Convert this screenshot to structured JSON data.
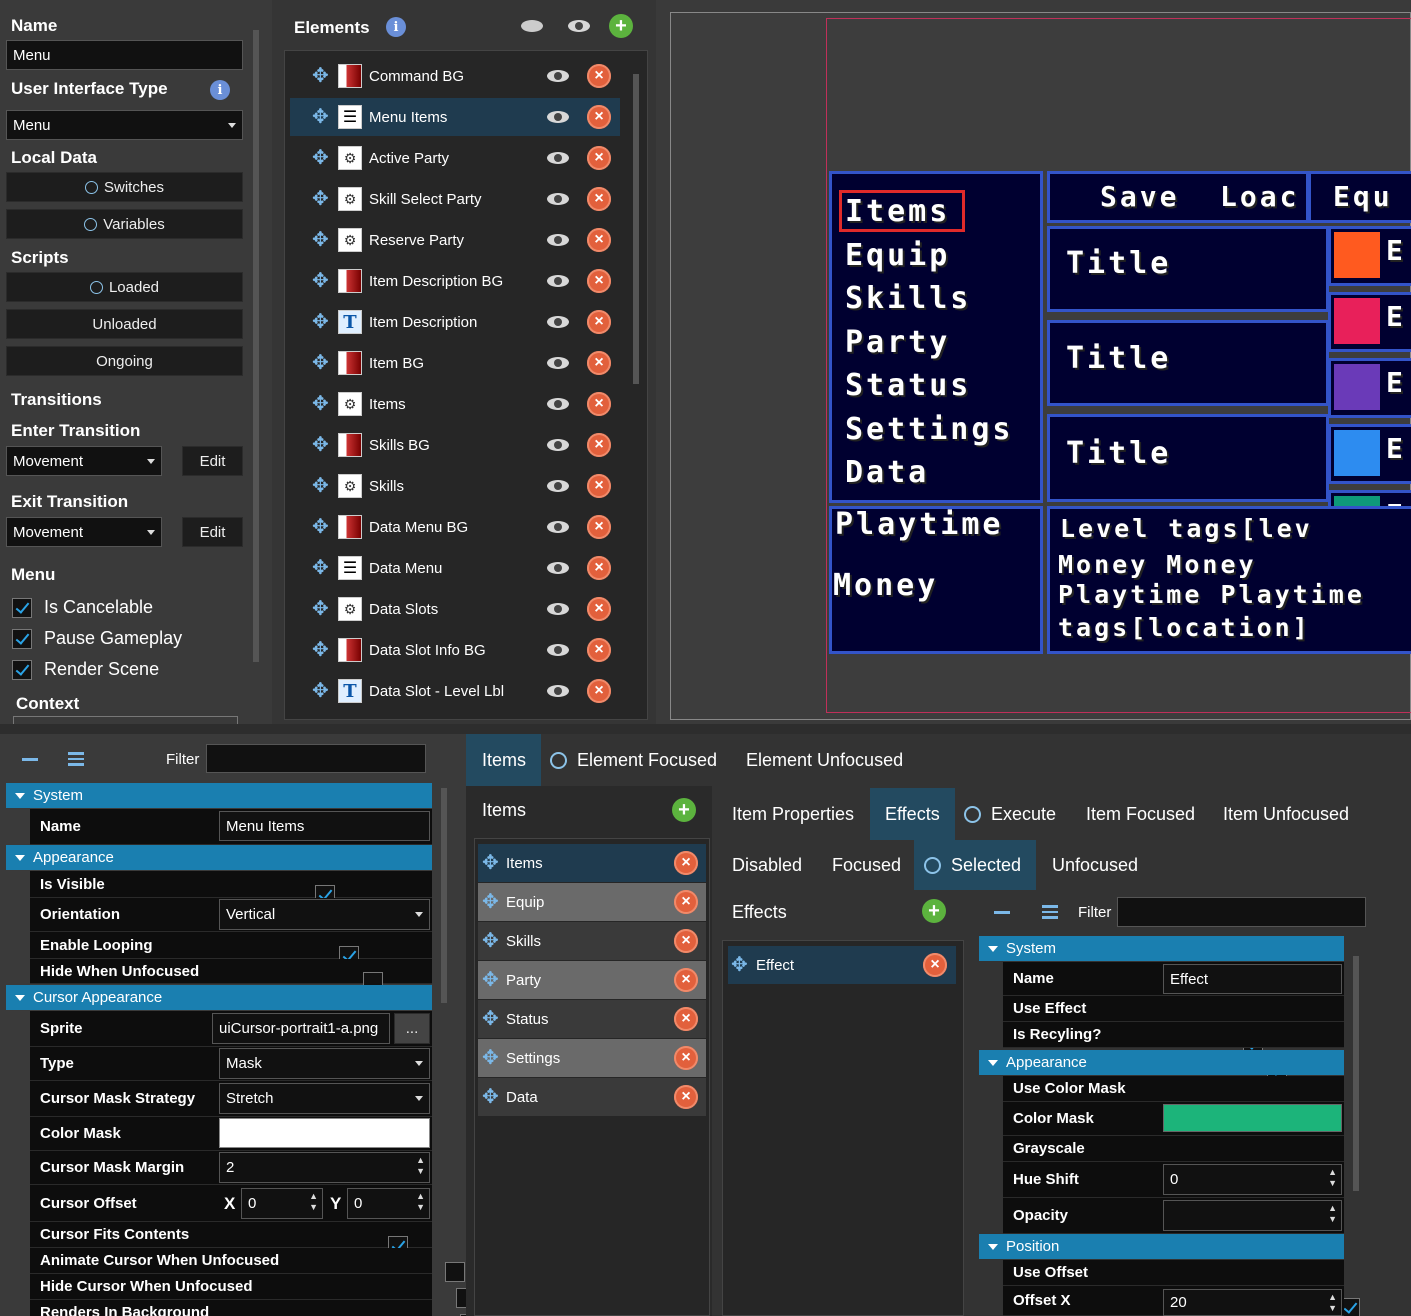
{
  "left_panel": {
    "name_label": "Name",
    "name_value": "Menu",
    "ui_type_label": "User Interface Type",
    "ui_type_value": "Menu",
    "local_data_label": "Local Data",
    "switches": "Switches",
    "variables": "Variables",
    "scripts_label": "Scripts",
    "loaded": "Loaded",
    "unloaded": "Unloaded",
    "ongoing": "Ongoing",
    "transitions_label": "Transitions",
    "enter_transition_label": "Enter Transition",
    "enter_transition_value": "Movement",
    "exit_transition_label": "Exit Transition",
    "exit_transition_value": "Movement",
    "edit": "Edit",
    "menu_label": "Menu",
    "is_cancelable": "Is Cancelable",
    "pause_gameplay": "Pause Gameplay",
    "render_scene": "Render Scene",
    "context_label": "Context"
  },
  "elements_panel": {
    "title": "Elements",
    "items": [
      {
        "label": "Command BG",
        "icon": "background-icon"
      },
      {
        "label": "Menu Items",
        "icon": "list-icon"
      },
      {
        "label": "Active Party",
        "icon": "grid-icon"
      },
      {
        "label": "Skill Select Party",
        "icon": "grid-icon"
      },
      {
        "label": "Reserve Party",
        "icon": "grid-icon"
      },
      {
        "label": "Item Description BG",
        "icon": "background-icon"
      },
      {
        "label": "Item Description",
        "icon": "text-icon"
      },
      {
        "label": "Item BG",
        "icon": "background-icon"
      },
      {
        "label": "Items",
        "icon": "grid-icon"
      },
      {
        "label": "Skills BG",
        "icon": "background-icon"
      },
      {
        "label": "Skills",
        "icon": "grid-icon"
      },
      {
        "label": "Data Menu BG",
        "icon": "background-icon"
      },
      {
        "label": "Data Menu",
        "icon": "list-icon"
      },
      {
        "label": "Data Slots",
        "icon": "grid-icon"
      },
      {
        "label": "Data Slot Info BG",
        "icon": "background-icon"
      },
      {
        "label": "Data Slot - Level Lbl",
        "icon": "text-icon"
      }
    ]
  },
  "preview": {
    "menu": [
      "Items",
      "Equip",
      "Skills",
      "Party",
      "Status",
      "Settings",
      "Data"
    ],
    "top": [
      "Save",
      "Loac",
      "Equ"
    ],
    "titles": [
      "Title",
      "Title",
      "Title"
    ],
    "playtime": "Playtime",
    "money": "Money",
    "info_lines": [
      "Level tags[lev",
      "Money Money",
      "Playtime Playtime",
      "tags[location]"
    ],
    "swatch_letter": "E",
    "swatches": [
      "#ff5a1f",
      "#e8205a",
      "#6a3ab8",
      "#2d8cf0",
      "#0e9a7a"
    ]
  },
  "props": {
    "filter": "Filter",
    "system": "System",
    "name": "Name",
    "name_value": "Menu Items",
    "appearance": "Appearance",
    "is_visible": "Is Visible",
    "orientation": "Orientation",
    "orientation_value": "Vertical",
    "enable_looping": "Enable Looping",
    "hide_when_unfocused": "Hide When Unfocused",
    "cursor_appearance": "Cursor Appearance",
    "sprite": "Sprite",
    "sprite_value": "uiCursor-portrait1-a.png",
    "browse": "...",
    "type": "Type",
    "type_value": "Mask",
    "cursor_mask_strategy": "Cursor Mask Strategy",
    "cursor_mask_strategy_value": "Stretch",
    "color_mask": "Color Mask",
    "cursor_mask_margin": "Cursor Mask Margin",
    "cursor_mask_margin_value": "2",
    "cursor_offset": "Cursor Offset",
    "x": "X",
    "y": "Y",
    "offset_x_value": "0",
    "offset_y_value": "0",
    "cursor_fits_contents": "Cursor Fits Contents",
    "animate_cursor": "Animate Cursor When Unfocused",
    "hide_cursor": "Hide Cursor When Unfocused",
    "renders_bg": "Renders In Background"
  },
  "tabs_top": {
    "items": "Items",
    "element_focused": "Element Focused",
    "element_unfocused": "Element Unfocused"
  },
  "items_list": {
    "title": "Items",
    "entries": [
      "Items",
      "Equip",
      "Skills",
      "Party",
      "Status",
      "Settings",
      "Data"
    ]
  },
  "item_tabs": {
    "item_properties": "Item Properties",
    "effects": "Effects",
    "execute": "Execute",
    "item_focused": "Item Focused",
    "item_unfocused": "Item Unfocused",
    "disabled": "Disabled",
    "focused": "Focused",
    "selected": "Selected",
    "unfocused": "Unfocused"
  },
  "effects": {
    "title": "Effects",
    "entry": "Effect"
  },
  "effect_props": {
    "filter": "Filter",
    "system": "System",
    "name": "Name",
    "name_value": "Effect",
    "use_effect": "Use Effect",
    "is_recyling": "Is Recyling?",
    "appearance": "Appearance",
    "use_color_mask": "Use Color Mask",
    "color_mask": "Color Mask",
    "color_mask_value": "#1cb47a",
    "grayscale": "Grayscale",
    "hue_shift": "Hue Shift",
    "hue_shift_value": "0",
    "opacity": "Opacity",
    "position": "Position",
    "use_offset": "Use Offset",
    "offset_x": "Offset X",
    "offset_x_value": "20"
  }
}
